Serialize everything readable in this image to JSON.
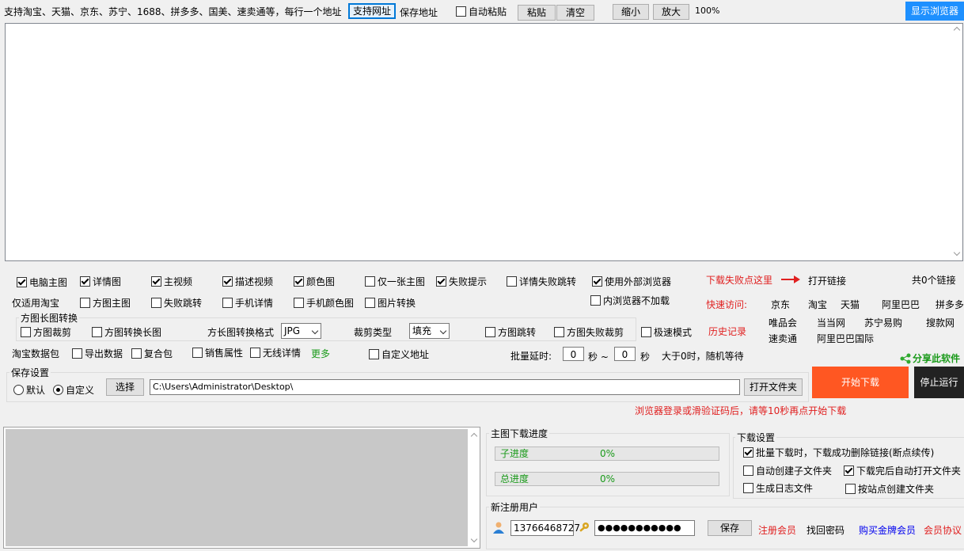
{
  "top": {
    "instruction": "支持淘宝、天猫、京东、苏宁、1688、拼多多、国美、速卖通等，每行一个地址",
    "supported_button": "支持网址",
    "save_address": "保存地址",
    "auto_paste": "自动粘贴",
    "paste": "粘贴",
    "clear": "清空",
    "zoom_out": "缩小",
    "zoom_in": "放大",
    "zoom_level": "100%",
    "show_browser": "显示浏览器"
  },
  "options": {
    "row1": [
      {
        "label": "电脑主图",
        "checked": true
      },
      {
        "label": "详情图",
        "checked": true
      },
      {
        "label": "主视频",
        "checked": true
      },
      {
        "label": "描述视频",
        "checked": true
      },
      {
        "label": "颜色图",
        "checked": true
      },
      {
        "label": "仅一张主图",
        "checked": false
      },
      {
        "label": "失败提示",
        "checked": true
      },
      {
        "label": "详情失败跳转",
        "checked": false
      },
      {
        "label": "使用外部浏览器",
        "checked": true
      }
    ],
    "taobao_only": "仅适用淘宝",
    "row2": [
      {
        "label": "方图主图",
        "checked": false
      },
      {
        "label": "失败跳转",
        "checked": false
      },
      {
        "label": "手机详情",
        "checked": false
      },
      {
        "label": "手机颜色图",
        "checked": false
      },
      {
        "label": "图片转换",
        "checked": false
      }
    ],
    "inner_browser": {
      "label": "内浏览器不加载",
      "checked": false
    },
    "fail_hint": "下载失败点这里",
    "open_link": "打开链接",
    "link_count": "共0个链接",
    "quick_visit": "快速访问:",
    "quick_links": [
      "京东",
      "淘宝",
      "天猫",
      "阿里巴巴",
      "拼多多",
      "唯品会",
      "当当网",
      "苏宁易购",
      "搜款网",
      "速卖通",
      "阿里巴巴国际"
    ],
    "convert_group": "方图长图转换",
    "square_crop": {
      "label": "方图裁剪",
      "checked": false
    },
    "square_to_long": {
      "label": "方图转换长图",
      "checked": false
    },
    "format_label": "方长图转换格式",
    "format_value": "JPG",
    "crop_type_label": "裁剪类型",
    "crop_type_value": "填充",
    "square_jump": {
      "label": "方图跳转",
      "checked": false
    },
    "square_fail_crop": {
      "label": "方图失败裁剪",
      "checked": false
    },
    "fast_mode": {
      "label": "极速模式",
      "checked": false
    },
    "history": "历史记录",
    "data_pack": "淘宝数据包",
    "row4": [
      {
        "label": "导出数据",
        "checked": false
      },
      {
        "label": "复合包",
        "checked": false
      },
      {
        "label": "销售属性",
        "checked": false
      },
      {
        "label": "无线详情",
        "checked": false
      }
    ],
    "more": "更多",
    "custom_addr": {
      "label": "自定义地址",
      "checked": false
    },
    "batch_delay": "批量延时:",
    "delay_from": "0",
    "sec1": "秒 ~",
    "delay_to": "0",
    "sec2": "秒",
    "random_wait": "大于0时，随机等待",
    "share": "分享此软件"
  },
  "save": {
    "title": "保存设置",
    "default": "默认",
    "custom": "自定义",
    "choose": "选择",
    "path": "C:\\Users\\Administrator\\Desktop\\",
    "open_folder": "打开文件夹",
    "start": "开始下载",
    "stop": "停止运行",
    "notice": "浏览器登录或滑验证码后，请等10秒再点开始下载"
  },
  "progress": {
    "title": "主图下载进度",
    "sub_label": "子进度",
    "sub_value": "0%",
    "sub_fraction": 0,
    "total_label": "总进度",
    "total_value": "0%",
    "total_fraction": 0
  },
  "download_settings": {
    "title": "下载设置",
    "batch_delete": {
      "label": "批量下载时，下载成功删除链接(断点续传)",
      "checked": true
    },
    "auto_subfolder": {
      "label": "自动创建子文件夹",
      "checked": false
    },
    "auto_open": {
      "label": "下载完后自动打开文件夹",
      "checked": true
    },
    "gen_log": {
      "label": "生成日志文件",
      "checked": false
    },
    "by_site": {
      "label": "按站点创建文件夹",
      "checked": false
    }
  },
  "user": {
    "title": "新注册用户",
    "phone": "13766468727",
    "password": "●●●●●●●●●●●",
    "save": "保存",
    "register": "注册会员",
    "recover": "找回密码",
    "buy_gold": "购买金牌会员",
    "agreement": "会员协议"
  },
  "colors": {
    "accent_blue": "#1e90ff",
    "start_orange": "#ff5722",
    "stop_dark": "#222222",
    "red_text": "#e02020"
  }
}
